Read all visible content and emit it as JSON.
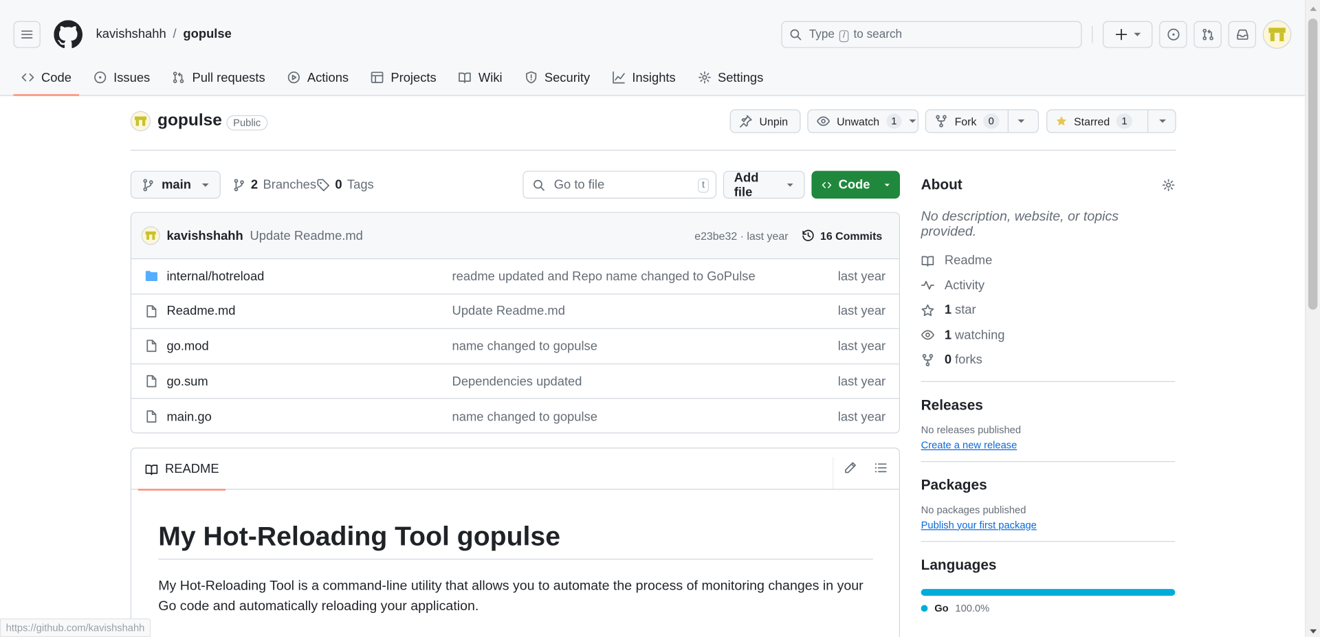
{
  "header": {
    "owner": "kavishshahh",
    "separator": "/",
    "repo": "gopulse",
    "search_prefix": "Type",
    "search_key": "/",
    "search_suffix": "to search"
  },
  "tabs": [
    {
      "label": "Code",
      "icon": "code-icon"
    },
    {
      "label": "Issues",
      "icon": "issue-opened-icon"
    },
    {
      "label": "Pull requests",
      "icon": "git-pull-request-icon"
    },
    {
      "label": "Actions",
      "icon": "play-icon"
    },
    {
      "label": "Projects",
      "icon": "table-icon"
    },
    {
      "label": "Wiki",
      "icon": "book-icon"
    },
    {
      "label": "Security",
      "icon": "shield-icon"
    },
    {
      "label": "Insights",
      "icon": "graph-icon"
    },
    {
      "label": "Settings",
      "icon": "gear-icon"
    }
  ],
  "repo_header": {
    "name": "gopulse",
    "visibility": "Public",
    "unpin": "Unpin",
    "unwatch": "Unwatch",
    "watch_count": "1",
    "fork": "Fork",
    "fork_count": "0",
    "starred": "Starred",
    "star_count": "1"
  },
  "file_nav": {
    "branch": "main",
    "branches_count": "2",
    "branches_label": "Branches",
    "tags_count": "0",
    "tags_label": "Tags",
    "goto_placeholder": "Go to file",
    "goto_key": "t",
    "add_file": "Add file",
    "code": "Code"
  },
  "commit": {
    "user": "kavishshahh",
    "message": "Update Readme.md",
    "hash_time": "e23be32 · last year",
    "count": "16 Commits"
  },
  "files": [
    {
      "name": "internal/hotreload",
      "type": "folder",
      "message": "readme updated and Repo name changed to GoPulse",
      "date": "last year"
    },
    {
      "name": "Readme.md",
      "type": "file",
      "message": "Update Readme.md",
      "date": "last year"
    },
    {
      "name": "go.mod",
      "type": "file",
      "message": "name changed to gopulse",
      "date": "last year"
    },
    {
      "name": "go.sum",
      "type": "file",
      "message": "Dependencies updated",
      "date": "last year"
    },
    {
      "name": "main.go",
      "type": "file",
      "message": "name changed to gopulse",
      "date": "last year"
    }
  ],
  "readme": {
    "tab": "README",
    "title": "My Hot-Reloading Tool gopulse",
    "body": "My Hot-Reloading Tool is a command-line utility that allows you to automate the process of monitoring changes in your Go code and automatically reloading your application."
  },
  "about": {
    "title": "About",
    "description": "No description, website, or topics provided.",
    "readme": "Readme",
    "activity": "Activity",
    "stars_num": "1",
    "stars_label": "star",
    "watching_num": "1",
    "watching_label": "watching",
    "forks_num": "0",
    "forks_label": "forks"
  },
  "releases": {
    "title": "Releases",
    "none": "No releases published",
    "link": "Create a new release"
  },
  "packages": {
    "title": "Packages",
    "none": "No packages published",
    "link": "Publish your first package"
  },
  "languages": {
    "title": "Languages",
    "items": [
      {
        "name": "Go",
        "percent": "100.0%",
        "color": "#00ADD8"
      }
    ]
  },
  "status_bar": {
    "url": "https://github.com/kavishshahh"
  },
  "colors": {
    "primary_green": "#1f883d",
    "tab_underline": "#fd8c73",
    "link_blue": "#0969da",
    "go_color": "#00ADD8"
  }
}
